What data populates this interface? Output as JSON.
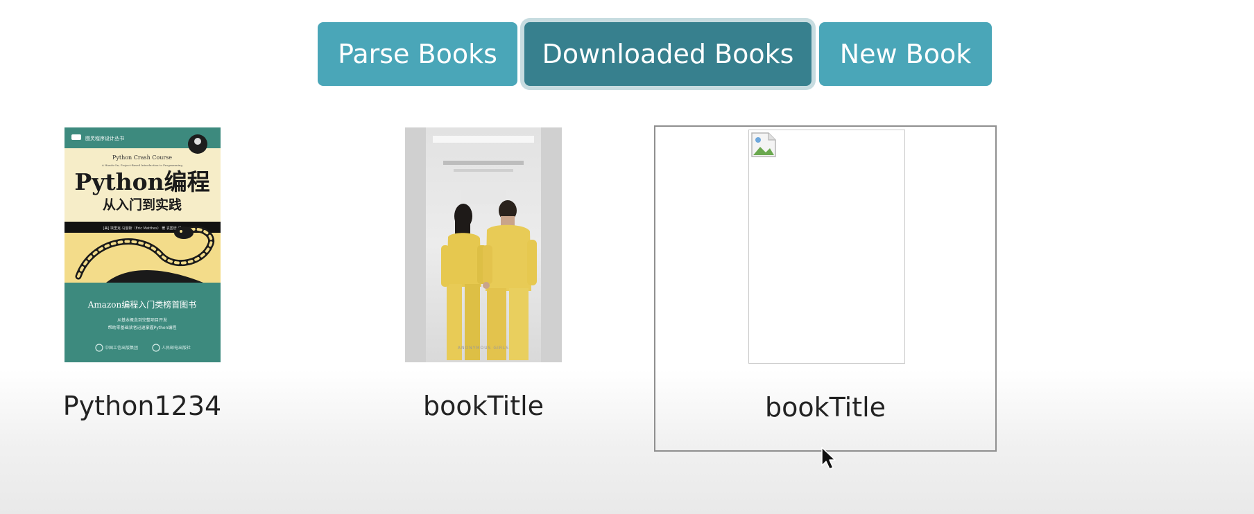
{
  "tabs": [
    {
      "label": "Parse Books",
      "active": false
    },
    {
      "label": "Downloaded Books",
      "active": true
    },
    {
      "label": "New Book",
      "active": false
    }
  ],
  "books": [
    {
      "title": "Python1234",
      "cover": {
        "publisher_series": "图灵程序设计丛书",
        "subtitle_en": "Python Crash Course",
        "tagline_en": "A Hands-On, Project-Based Introduction to Programming",
        "title_cn": "Python编程",
        "subtitle_cn": "从入门到实践",
        "author_line": "[美] 埃里克·马瑟斯（Eric Matthes） 著 袁国忠 译",
        "badge": "Amazon编程入门类榜首图书",
        "blurb_1": "从基本概念到完整项目开发",
        "blurb_2": "帮助零基础读者迅速掌握Python编程",
        "publisher_1": "中国工信出版集团",
        "publisher_2": "人民邮电出版社"
      }
    },
    {
      "title": "bookTitle",
      "cover": {
        "caption": "ANONYMOUS GIRLS"
      }
    },
    {
      "title": "bookTitle",
      "cover": {
        "broken_image": true
      },
      "selected": true
    }
  ],
  "colors": {
    "tab": "#4aa6b8",
    "tab_active": "#37808e",
    "python_cover_green": "#3d8a7e",
    "python_cover_cream": "#f6edc8",
    "python_cover_yellow": "#f3dc8a",
    "jumpsuit_yellow": "#e6c84f"
  }
}
